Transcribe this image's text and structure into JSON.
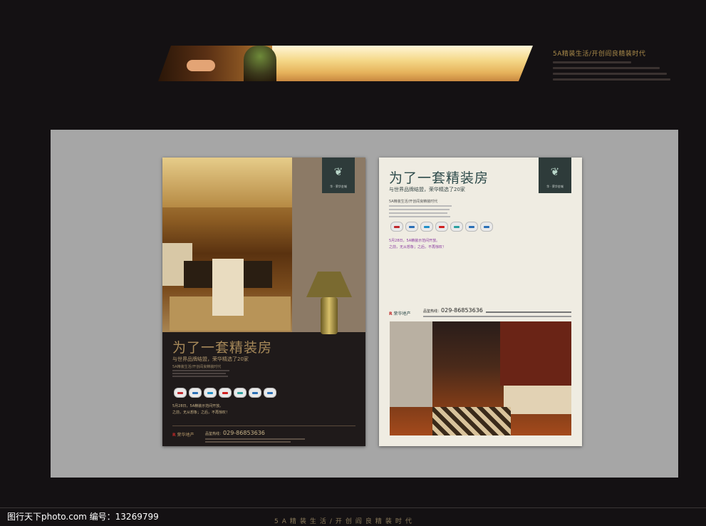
{
  "banner": {
    "slogan": "5A精装生活/开创阎良精装时代"
  },
  "poster_dark": {
    "logo_text": "华 · 荣华金城",
    "headline": "为了一套精装房",
    "subheadline": "与世界品牌结盟，荣华精选了20家",
    "tagline": "5A精装生活/开创阎良精装时代",
    "promo_line1": "5月28日，5A精装示范间开放。",
    "promo_line2": "之前，无从想象；之后，不再惊叹！",
    "dev_name": "荣华地产",
    "hotline_label": "品鉴热线：",
    "hotline": "029-86853636"
  },
  "poster_light": {
    "logo_text": "华 · 荣华金城",
    "headline": "为了一套精装房",
    "subheadline": "与世界品牌结盟，荣华精选了20家",
    "tagline": "5A精装生活/开创阎良精装时代",
    "promo_line1": "5月28日，5A精装示范间开放。",
    "promo_line2": "之前，无从想象；之后，不再惊叹！",
    "dev_name": "荣华地产",
    "hotline_label": "品鉴热线：",
    "hotline": "029-86853636"
  },
  "brand_colors": [
    "#c0282d",
    "#2a6fb5",
    "#1f8fc7",
    "#d02020",
    "#2aa0a0",
    "#2a6fb5",
    "#2a6fb5"
  ],
  "footer": {
    "slogan": "5A精装生活/开创阎良精装时代",
    "watermark": "图行天下photo.com    编号：13269799"
  }
}
